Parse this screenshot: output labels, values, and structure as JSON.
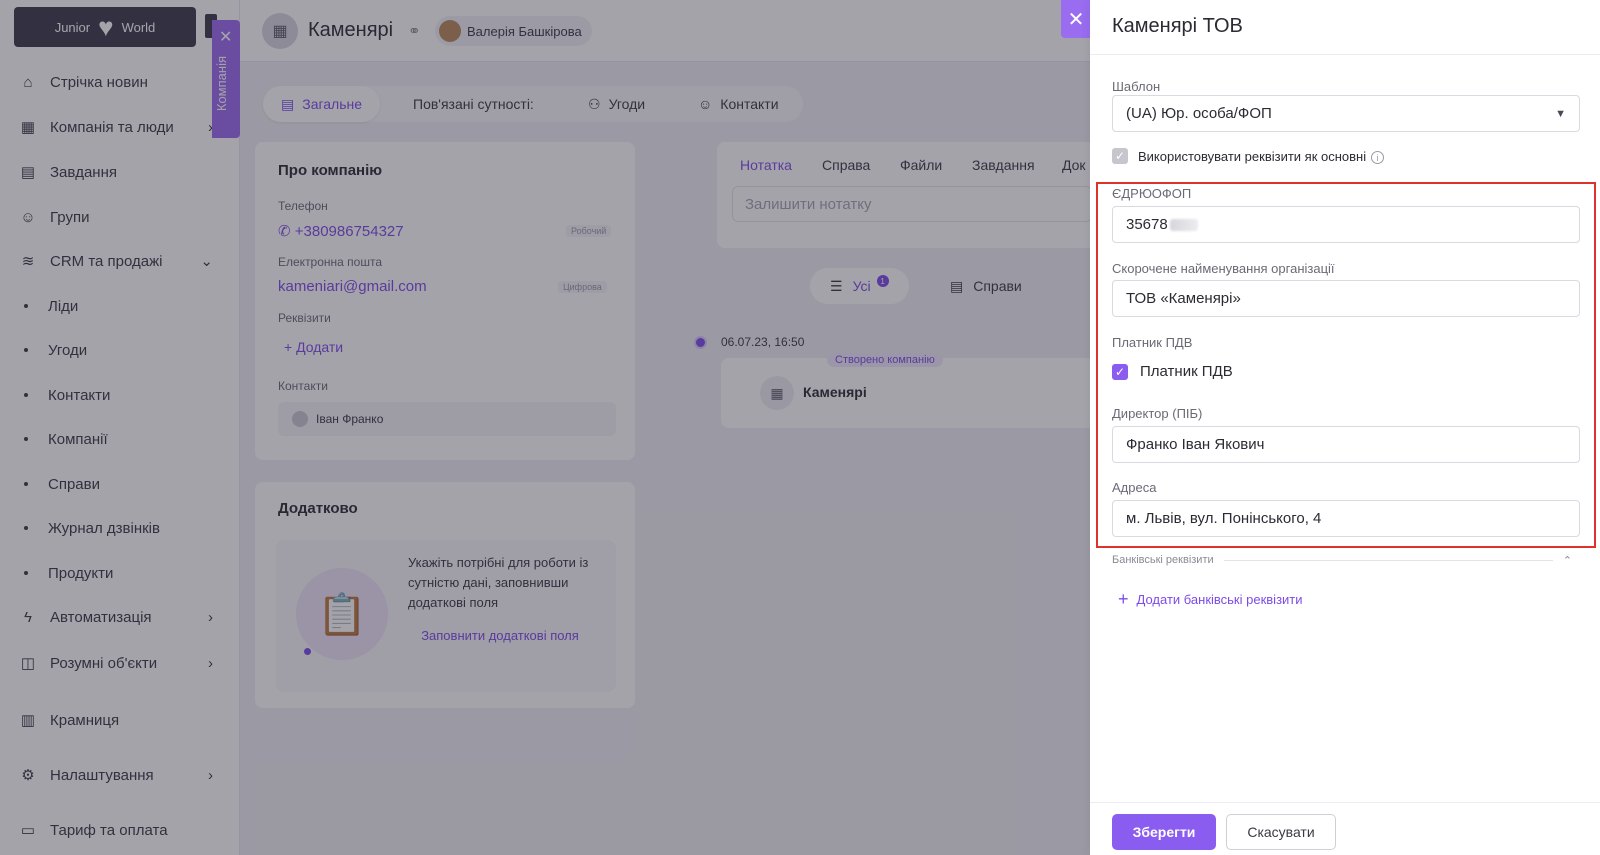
{
  "sidebar": {
    "logo_left": "Junior",
    "logo_right": "World",
    "company_tab_label": "Компанія",
    "items": [
      {
        "label": "Стрічка новин",
        "icon": "home-icon"
      },
      {
        "label": "Компанія та люди",
        "icon": "building-icon"
      },
      {
        "label": "Завдання",
        "icon": "calendar-icon"
      },
      {
        "label": "Групи",
        "icon": "users-icon"
      },
      {
        "label": "CRM та продажі",
        "icon": "crm-icon"
      },
      {
        "label": "Ліди"
      },
      {
        "label": "Угоди"
      },
      {
        "label": "Контакти"
      },
      {
        "label": "Компанії"
      },
      {
        "label": "Справи"
      },
      {
        "label": "Журнал дзвінків"
      },
      {
        "label": "Продукти"
      },
      {
        "label": "Автоматизація",
        "icon": "lightning-icon"
      },
      {
        "label": "Розумні об'єкти",
        "icon": "smart-object-icon"
      },
      {
        "label": "Крамниця",
        "icon": "store-icon"
      },
      {
        "label": "Налаштування",
        "icon": "gear-icon"
      },
      {
        "label": "Тариф та оплата",
        "icon": "tariff-icon"
      }
    ]
  },
  "header": {
    "title": "Каменярі",
    "owner": "Валерія Башкірова"
  },
  "tabs": {
    "general": "Загальне",
    "related": "Пов'язані сутності:",
    "deals": "Угоди",
    "contacts": "Контакти"
  },
  "about": {
    "title": "Про компанію",
    "phone_label": "Телефон",
    "phone": "+380986754327",
    "phone_tag": "Робочий",
    "email_label": "Електронна пошта",
    "email": "kameniari@gmail.com",
    "email_tag": "Цифрова",
    "requisites_label": "Реквізити",
    "add_label": "Додати",
    "contacts_label": "Контакти",
    "contact_name": "Іван Франко"
  },
  "extra": {
    "title": "Додатково",
    "text": "Укажіть потрібні для роботи із сутністю дані, заповнивши додаткові поля",
    "link": "Заповнити додаткові поля"
  },
  "activity": {
    "tabs": [
      "Нотатка",
      "Справа",
      "Файли",
      "Завдання",
      "Док"
    ],
    "note_placeholder": "Залишити нотатку",
    "filter_all": "Усі",
    "filter_all_count": "1",
    "filter_deals": "Справи",
    "event_date": "06.07.23, 16:50",
    "event_tag": "Створено компанію",
    "event_name": "Каменярі"
  },
  "drawer": {
    "title": "Каменярі ТОВ",
    "template_label": "Шаблон",
    "template_value": "(UA) Юр. особа/ФОП",
    "use_as_main_label": "Використовувати реквізити як основні",
    "edrpou_label": "ЄДРЮОФОП",
    "edrpou_value": "35678",
    "short_name_label": "Скорочене найменування організації",
    "short_name_value": "ТОВ «Каменярі»",
    "vat_label": "Платник ПДВ",
    "vat_checkbox_label": "Платник ПДВ",
    "director_label": "Директор (ПІБ)",
    "director_value": "Франко Іван Якович",
    "address_label": "Адреса",
    "address_value": "м. Львів, вул. Понінського, 4",
    "bank_section_label": "Банківські реквізити",
    "add_bank_label": "Додати банківські реквізити",
    "save_label": "Зберегти",
    "cancel_label": "Скасувати"
  },
  "colors": {
    "accent": "#8b5cf0",
    "highlight": "#e0322c"
  }
}
